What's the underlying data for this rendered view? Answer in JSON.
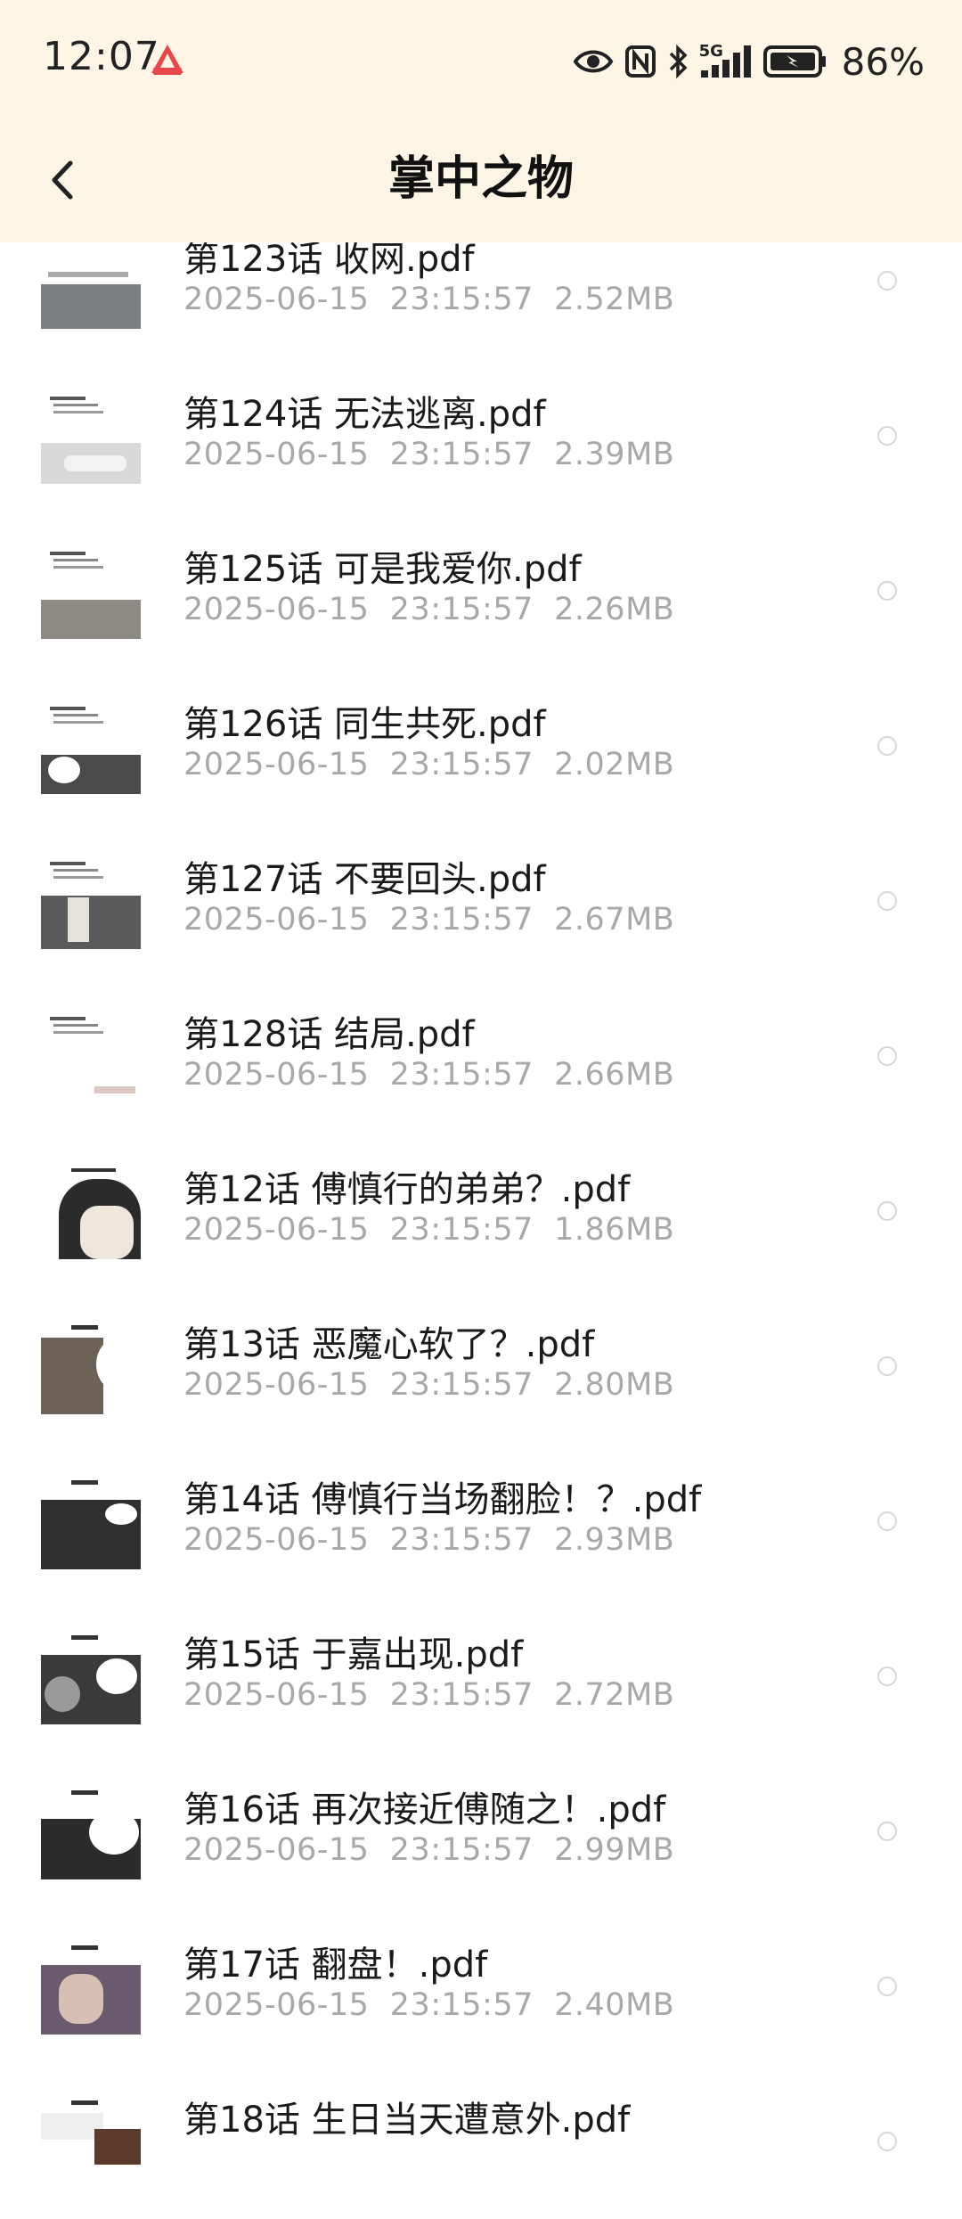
{
  "status_bar": {
    "time": "12:07",
    "network": "5G",
    "battery": "86%"
  },
  "nav": {
    "title": "掌中之物"
  },
  "files": [
    {
      "name": "第123话 收网.pdf",
      "date": "2025-06-15",
      "time": "23:15:57",
      "size": "2.52MB"
    },
    {
      "name": "第124话 无法逃离.pdf",
      "date": "2025-06-15",
      "time": "23:15:57",
      "size": "2.39MB"
    },
    {
      "name": "第125话 可是我爱你.pdf",
      "date": "2025-06-15",
      "time": "23:15:57",
      "size": "2.26MB"
    },
    {
      "name": "第126话 同生共死.pdf",
      "date": "2025-06-15",
      "time": "23:15:57",
      "size": "2.02MB"
    },
    {
      "name": "第127话 不要回头.pdf",
      "date": "2025-06-15",
      "time": "23:15:57",
      "size": "2.67MB"
    },
    {
      "name": "第128话 结局.pdf",
      "date": "2025-06-15",
      "time": "23:15:57",
      "size": "2.66MB"
    },
    {
      "name": "第12话 傅慎行的弟弟？.pdf",
      "date": "2025-06-15",
      "time": "23:15:57",
      "size": "1.86MB"
    },
    {
      "name": "第13话 恶魔心软了？.pdf",
      "date": "2025-06-15",
      "time": "23:15:57",
      "size": "2.80MB"
    },
    {
      "name": "第14话 傅慎行当场翻脸！？.pdf",
      "date": "2025-06-15",
      "time": "23:15:57",
      "size": "2.93MB"
    },
    {
      "name": "第15话 于嘉出现.pdf",
      "date": "2025-06-15",
      "time": "23:15:57",
      "size": "2.72MB"
    },
    {
      "name": "第16话 再次接近傅随之！.pdf",
      "date": "2025-06-15",
      "time": "23:15:57",
      "size": "2.99MB"
    },
    {
      "name": "第17话 翻盘！.pdf",
      "date": "2025-06-15",
      "time": "23:15:57",
      "size": "2.40MB"
    },
    {
      "name": "第18话 生日当天遭意外.pdf",
      "date": "",
      "time": "",
      "size": ""
    }
  ]
}
